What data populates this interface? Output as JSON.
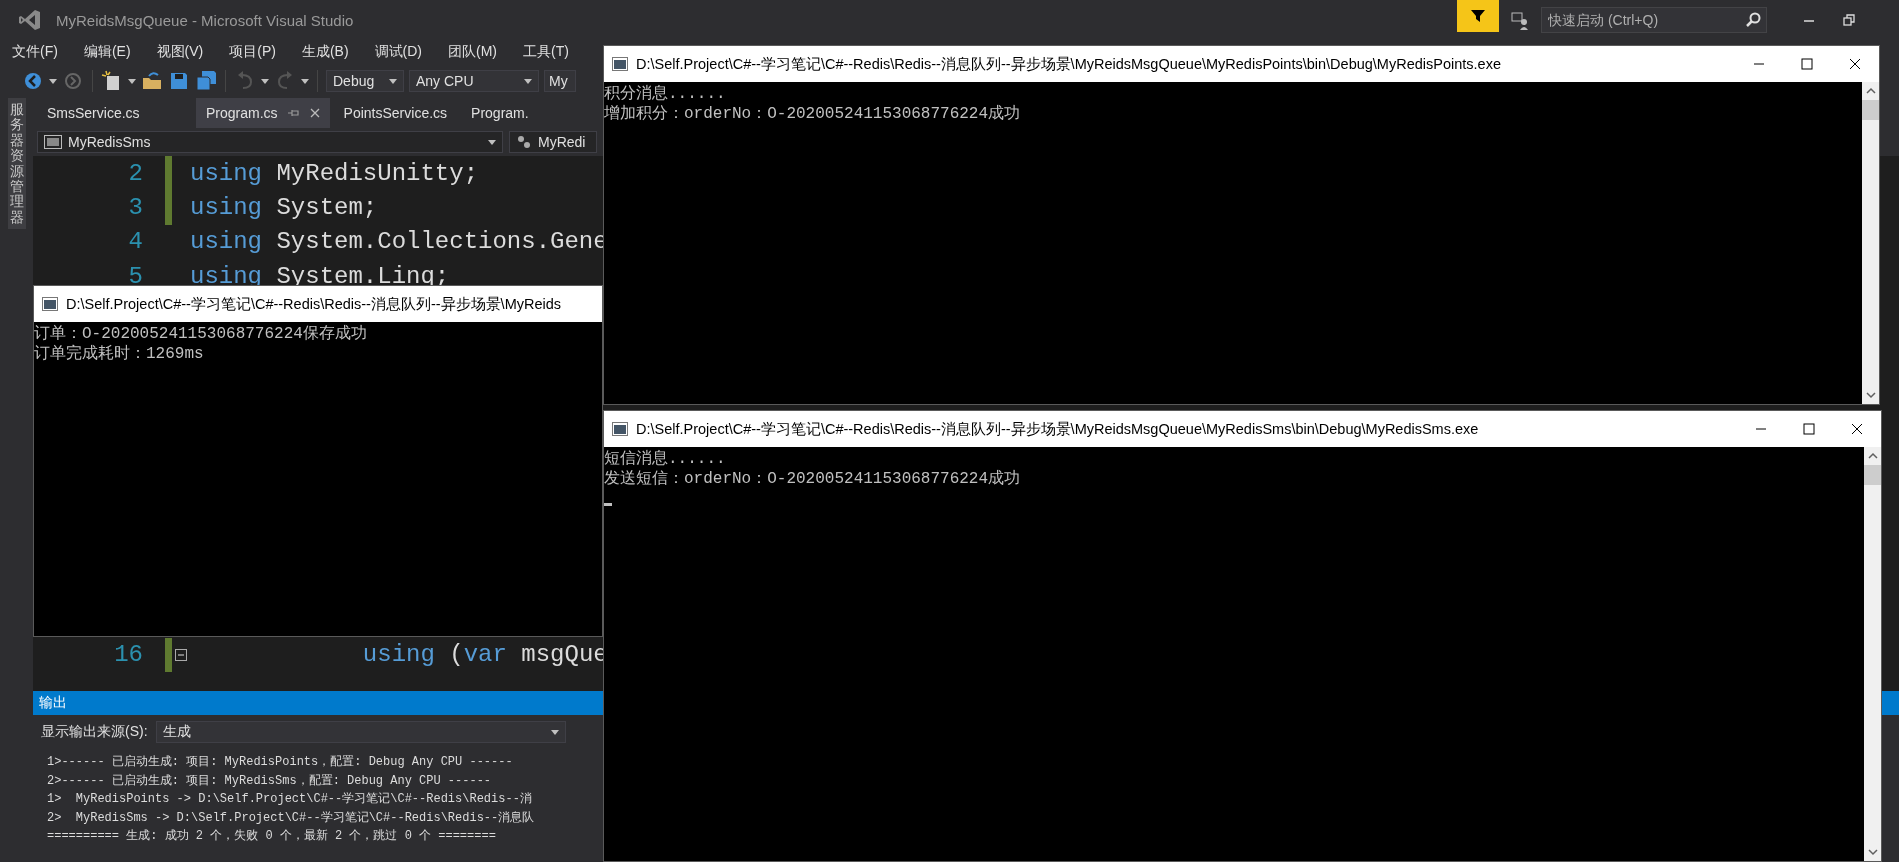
{
  "window": {
    "title": "MyReidsMsgQueue - Microsoft Visual Studio"
  },
  "quick_launch": {
    "placeholder": "快速启动 (Ctrl+Q)"
  },
  "menu": [
    "文件(F)",
    "编辑(E)",
    "视图(V)",
    "项目(P)",
    "生成(B)",
    "调试(D)",
    "团队(M)",
    "工具(T)"
  ],
  "toolbar": {
    "configuration": "Debug",
    "platform": "Any CPU",
    "startup_project": "My"
  },
  "side_tab": "服务器资源管理器",
  "doc_tabs": [
    {
      "label": "SmsService.cs",
      "selected": false
    },
    {
      "label": "Program.cs",
      "selected": true
    },
    {
      "label": "PointsService.cs",
      "selected": false
    },
    {
      "label": "Program.",
      "selected": false
    }
  ],
  "nav_bar": {
    "project": "MyRedisSms",
    "member": "MyRedi"
  },
  "code_lines": [
    {
      "number": "2",
      "changed": true,
      "foldable": false,
      "indented": false,
      "tokens": [
        {
          "kind": "keyword",
          "text": "using"
        },
        {
          "kind": "plain",
          "text": " MyRedisUnitty;"
        }
      ]
    },
    {
      "number": "3",
      "changed": true,
      "foldable": false,
      "indented": false,
      "tokens": [
        {
          "kind": "keyword",
          "text": "using"
        },
        {
          "kind": "plain",
          "text": " System;"
        }
      ]
    },
    {
      "number": "4",
      "changed": false,
      "foldable": false,
      "indented": false,
      "tokens": [
        {
          "kind": "keyword",
          "text": "using"
        },
        {
          "kind": "plain",
          "text": " System.Collections.Gene"
        }
      ]
    },
    {
      "number": "5",
      "changed": false,
      "foldable": false,
      "indented": false,
      "tokens": [
        {
          "kind": "keyword",
          "text": "using"
        },
        {
          "kind": "plain",
          "text": " System.Linq;"
        }
      ]
    },
    {
      "number": "16",
      "changed": true,
      "foldable": true,
      "indented": true,
      "tokens": [
        {
          "kind": "keyword",
          "text": "using"
        },
        {
          "kind": "plain",
          "text": " ("
        },
        {
          "kind": "keyword",
          "text": "var"
        },
        {
          "kind": "plain",
          "text": " msgQue"
        }
      ]
    }
  ],
  "output": {
    "title": "输出",
    "source_label": "显示输出来源(S):",
    "source": "生成",
    "lines": [
      "1>------ 已启动生成: 项目: MyRedisPoints，配置: Debug Any CPU ------",
      "2>------ 已启动生成: 项目: MyRedisSms，配置: Debug Any CPU ------",
      "1>  MyRedisPoints -> D:\\Self.Project\\C#--学习笔记\\C#--Redis\\Redis--消",
      "2>  MyRedisSms -> D:\\Self.Project\\C#--学习笔记\\C#--Redis\\Redis--消息队",
      "========== 生成: 成功 2 个，失败 0 个，最新 2 个，跳过 0 个 ========"
    ]
  },
  "consoles": [
    {
      "title": "D:\\Self.Project\\C#--学习笔记\\C#--Redis\\Redis--消息队列--异步场景\\MyReids",
      "right_edge_visible": false,
      "cursor": false,
      "lines": [
        "订单：O-202005241153068776224保存成功",
        "订单完成耗时：1269ms"
      ]
    },
    {
      "title": "D:\\Self.Project\\C#--学习笔记\\C#--Redis\\Redis--消息队列--异步场景\\MyReidsMsgQueue\\MyRedisPoints\\bin\\Debug\\MyRedisPoints.exe",
      "right_edge_visible": true,
      "cursor": false,
      "lines": [
        "积分消息......",
        "增加积分：orderNo：O-202005241153068776224成功"
      ]
    },
    {
      "title": "D:\\Self.Project\\C#--学习笔记\\C#--Redis\\Redis--消息队列--异步场景\\MyReidsMsgQueue\\MyRedisSms\\bin\\Debug\\MyRedisSms.exe",
      "right_edge_visible": true,
      "cursor": true,
      "lines": [
        "短信消息......",
        "发送短信：orderNo：O-202005241153068776224成功"
      ]
    }
  ]
}
